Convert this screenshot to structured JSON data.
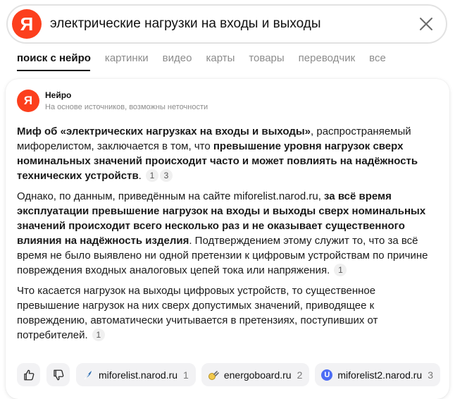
{
  "search": {
    "logo": "Я",
    "query": "электрические нагрузки на входы и выходы",
    "clear_icon": "close-icon"
  },
  "tabs": [
    {
      "label": "поиск с нейро",
      "active": true
    },
    {
      "label": "картинки"
    },
    {
      "label": "видео"
    },
    {
      "label": "карты"
    },
    {
      "label": "товары"
    },
    {
      "label": "переводчик"
    },
    {
      "label": "все"
    }
  ],
  "answer": {
    "name": "Нейро",
    "subtitle": "На основе источников, возможны неточности",
    "p1": {
      "b1": "Миф об «электрических нагрузках на входы и выходы»",
      "t1": ", распространяемый мифорелистом, заключается в том, что ",
      "b2": "превышение уровня нагрузок сверх номинальных значений происходит часто и может повлиять на надёжность технических устройств",
      "t2": ".",
      "refs": [
        "1",
        "3"
      ]
    },
    "p2": {
      "t1": "Однако, по данным, приведённым на сайте miforelist.narod.ru, ",
      "b1": "за всё время эксплуатации превышение нагрузок на входы и выходы сверх номинальных значений происходит всего несколько раз и не оказывает существенного влияния на надёжность изделия",
      "t2": ". Подтверждением этому служит то, что за всё время не было выявлено ни одной претензии к цифровым устройствам по причине повреждения входных аналоговых цепей тока или напряжения.",
      "ref": "1"
    },
    "p3": {
      "t1": "Что касается нагрузок на выходы цифровых устройств, то существенное превышение нагрузок на них сверх допустимых значений, приводящее к повреждению, автоматически учитывается в претензиях, поступивших от потребителей.",
      "ref": "1"
    }
  },
  "sources": [
    {
      "label": "miforelist.narod.ru",
      "count": "1"
    },
    {
      "label": "energoboard.ru",
      "count": "2"
    },
    {
      "label": "miforelist2.narod.ru",
      "count": "3",
      "icon_letter": "U"
    }
  ],
  "colors": {
    "brand": "#fc3f1d",
    "chip_bg": "#f2f2f4",
    "muted": "#8c8c8c"
  }
}
